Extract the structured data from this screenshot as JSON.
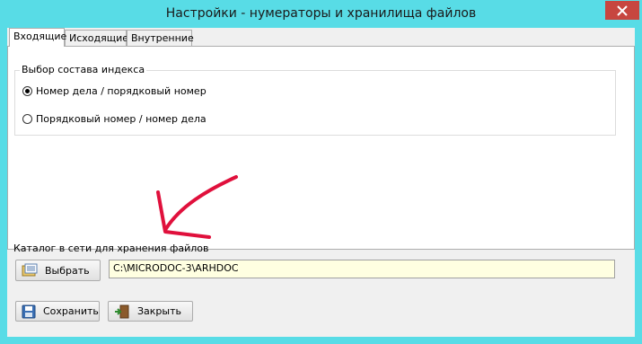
{
  "window": {
    "title": "Настройки - нумераторы и хранилища файлов",
    "close_icon": "close-icon"
  },
  "tabs": [
    {
      "label": "Входящие",
      "active": true
    },
    {
      "label": "Исходящие",
      "active": false
    },
    {
      "label": "Внутренние",
      "active": false
    }
  ],
  "group": {
    "title": "Выбор состава индекса",
    "options": [
      {
        "label": "Номер дела / порядковый номер",
        "checked": true
      },
      {
        "label": "Порядковый номер / номер дела",
        "checked": false
      }
    ]
  },
  "storage": {
    "label": "Каталог в сети для хранения файлов",
    "select_button": "Выбрать",
    "path_value": "C:\\MICRODOC-3\\ARHDOC"
  },
  "footer": {
    "save_button": "Сохранить",
    "close_button": "Закрыть"
  },
  "colors": {
    "titlebar": "#58dce6",
    "close_button": "#c7463f",
    "annotation_arrow": "#e0103c",
    "path_field": "#ffffe1"
  }
}
